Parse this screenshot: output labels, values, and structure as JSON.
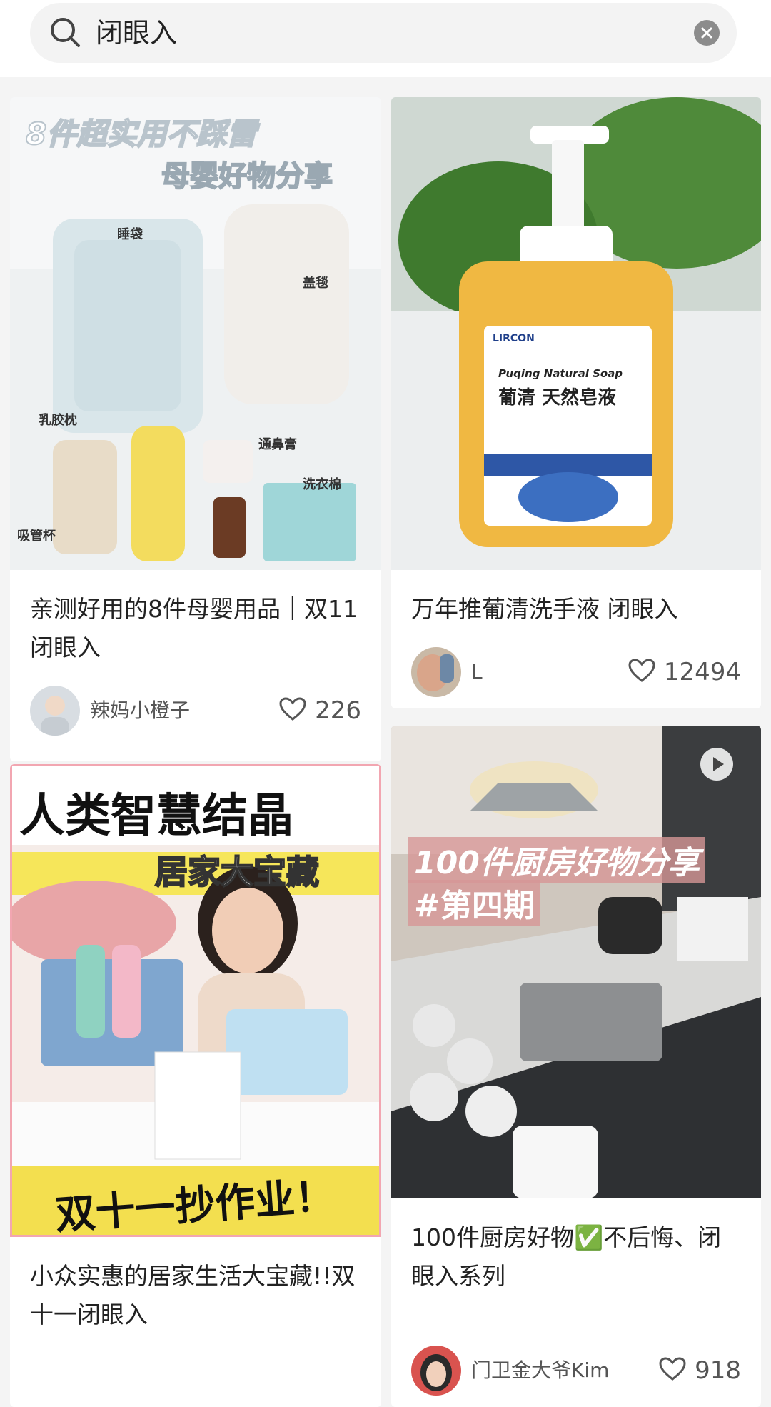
{
  "search": {
    "query": "闭眼入"
  },
  "cards": [
    {
      "title": "亲测好用的8件母婴用品｜双11闭眼入",
      "author": "辣妈小橙子",
      "likes": "226",
      "image_text": {
        "line1": "8件超实用不踩雷",
        "line2": "母婴好物分享",
        "tags": [
          "睡袋",
          "盖毯",
          "乳胶枕",
          "通鼻膏",
          "洗衣棉",
          "吸管杯"
        ]
      }
    },
    {
      "title": "万年推葡清洗手液 闭眼入",
      "author": "L",
      "likes": "12494",
      "image_text": {
        "brand": "LIRCON",
        "en": "Puqing Natural Soap",
        "cn": "葡清 天然皂液"
      }
    },
    {
      "title": "小众实惠的居家生活大宝藏!!双十一闭眼入",
      "author": "",
      "likes": "",
      "image_text": {
        "line1": "人类智慧结晶",
        "line2": "居家大宝藏",
        "line3": "双十一抄作业！"
      }
    },
    {
      "title": "100件厨房好物✅不后悔、闭眼入系列",
      "author": "门卫金大爷Kim",
      "likes": "918",
      "image_text": {
        "line1": "100件厨房好物分享",
        "line2": "#第四期"
      }
    }
  ],
  "colors": {
    "accent_yellow": "#f7e34a",
    "pink_border": "#f2a6b1"
  }
}
